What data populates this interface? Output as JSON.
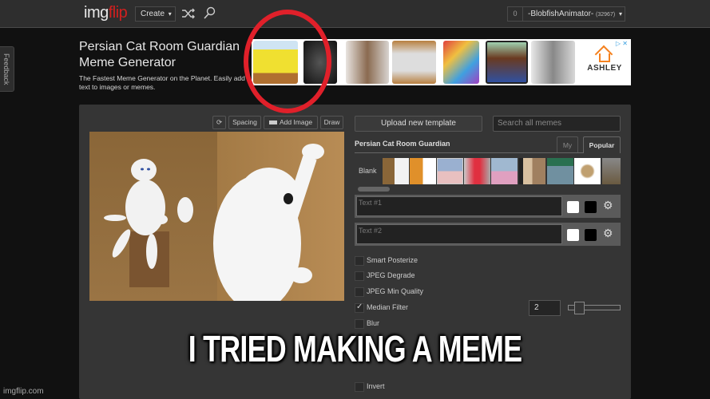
{
  "header": {
    "logo_part1": "img",
    "logo_part2": "flip",
    "create_label": "Create",
    "caret": "▾",
    "notifications_count": "0",
    "username": "-BlobfishAnimator-",
    "user_points": "(32967)"
  },
  "feedback_label": "Feedback",
  "page": {
    "title": "Persian Cat Room Guardian Meme Generator",
    "subtitle": "The Fastest Meme Generator on the Planet. Easily add text to images or memes."
  },
  "ad": {
    "brand": "ASHLEY",
    "close_icon": "▷ ✕"
  },
  "toolbar": {
    "rotate_icon": "⟳",
    "spacing_label": "Spacing",
    "add_image_label": "Add Image",
    "draw_label": "Draw"
  },
  "templates": {
    "upload_label": "Upload new template",
    "search_placeholder": "Search all memes",
    "current_name": "Persian Cat Room Guardian",
    "tab_my": "My",
    "tab_popular": "Popular",
    "blank_label": "Blank"
  },
  "text_boxes": [
    {
      "placeholder": "Text #1",
      "fill_color": "#ffffff",
      "outline_color": "#000000"
    },
    {
      "placeholder": "Text #2",
      "fill_color": "#ffffff",
      "outline_color": "#000000"
    }
  ],
  "options": [
    {
      "label": "Smart Posterize",
      "checked": false
    },
    {
      "label": "JPEG Degrade",
      "checked": false
    },
    {
      "label": "JPEG Min Quality",
      "checked": false
    },
    {
      "label": "Median Filter",
      "checked": true
    },
    {
      "label": "Blur",
      "checked": false
    },
    {
      "label": "Invert",
      "checked": false
    }
  ],
  "median_filter_value": "2",
  "overlay": {
    "caption": "I TRIED MAKING A MEME",
    "watermark": "imgflip.com"
  },
  "colors": {
    "brand_red": "#d0201f",
    "annotation_red": "#e0202a"
  }
}
